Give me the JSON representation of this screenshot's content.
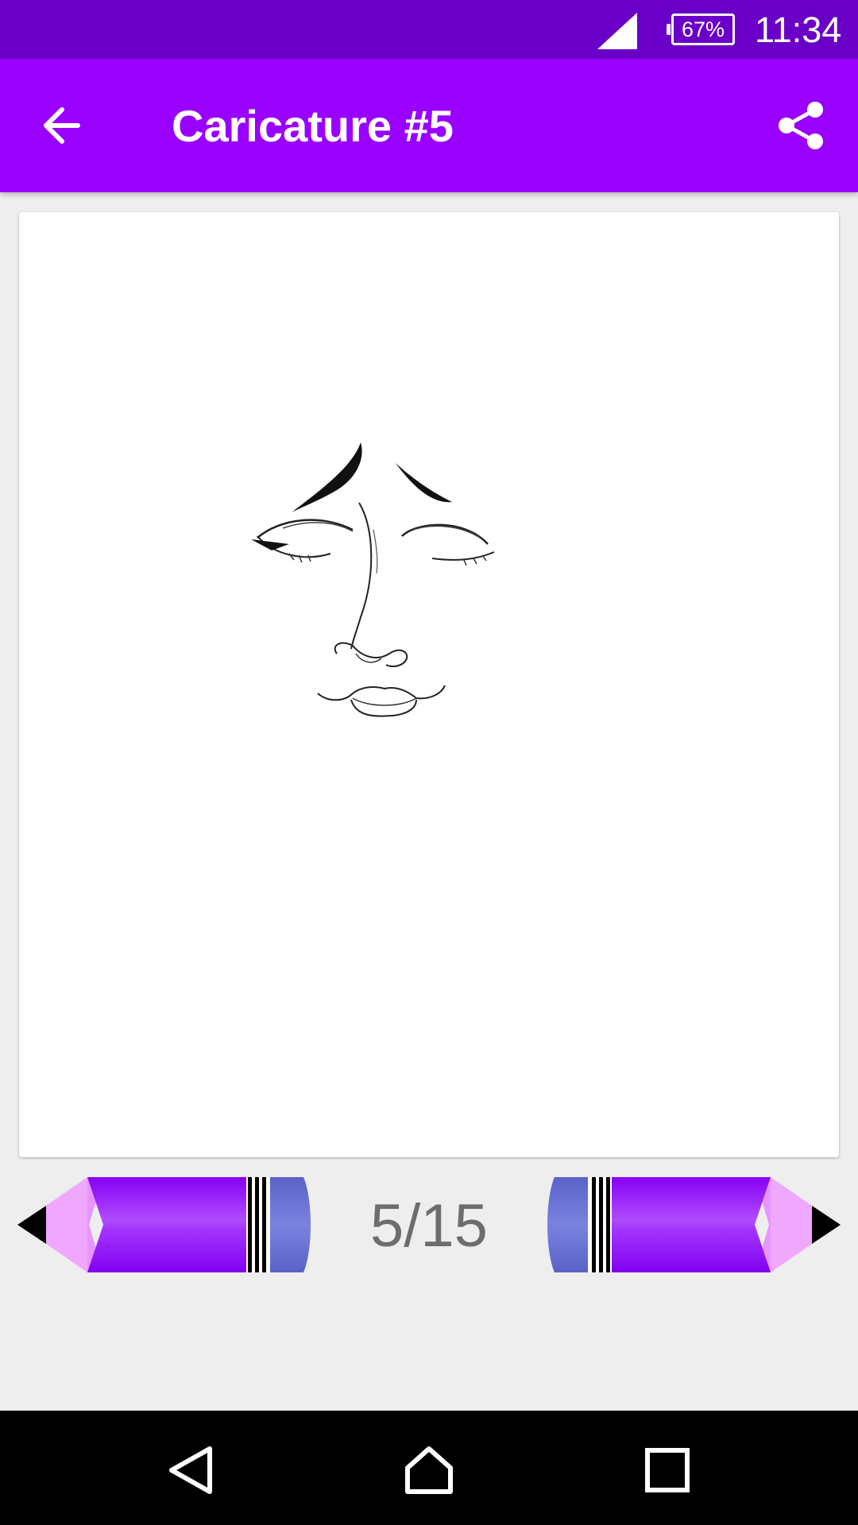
{
  "status_bar": {
    "battery": "67%",
    "time": "11:34"
  },
  "app_bar": {
    "title": "Caricature #5",
    "back_icon": "arrow-left-icon",
    "share_icon": "share-icon"
  },
  "pager": {
    "counter": "5/15",
    "prev_icon": "pencil-left-icon",
    "next_icon": "pencil-right-icon"
  },
  "colors": {
    "status_bar": "#6a00c8",
    "app_bar": "#9900ff",
    "pencil_body": "#8a00ff",
    "eraser": "#6a73d6",
    "background": "#eeeeee"
  },
  "system_nav": {
    "icons": [
      "back-triangle-icon",
      "home-icon",
      "recents-square-icon"
    ]
  }
}
